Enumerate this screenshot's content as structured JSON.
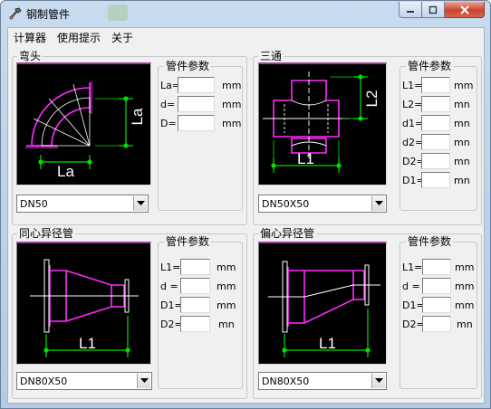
{
  "window": {
    "title": "钢制管件"
  },
  "menu": [
    "计算器",
    "使用提示",
    "关于"
  ],
  "unit_mm": "mm",
  "unit_mn": "mn",
  "panels": {
    "elbow": {
      "title": "弯头",
      "select_value": "DN50",
      "params_title": "管件参数",
      "fields": [
        "La=",
        "d=",
        "D="
      ],
      "dim_labels": [
        "La",
        "La"
      ]
    },
    "tee": {
      "title": "三通",
      "select_value": "DN50X50",
      "params_title": "管件参数",
      "fields": [
        "L1=",
        "L2=",
        "d1=",
        "d2=",
        "D2=",
        "D1="
      ],
      "dim_labels": [
        "L1",
        "L2"
      ]
    },
    "concentric": {
      "title": "同心异径管",
      "select_value": "DN80X50",
      "params_title": "管件参数",
      "fields": [
        "L1=",
        "d =",
        "D1=",
        "D2="
      ],
      "dim_labels": [
        "L1"
      ]
    },
    "eccentric": {
      "title": "偏心异径管",
      "select_value": "DN80X50",
      "params_title": "管件参数",
      "fields": [
        "L1=",
        "d =",
        "D1=",
        "D2="
      ],
      "dim_labels": [
        "L1"
      ]
    }
  },
  "icons": {
    "app": "pipe-wrench-icon",
    "dropdown": "chevron-down-icon"
  },
  "colors": {
    "pipe": "#ff2cff",
    "dimension": "#00e000",
    "centerline": "#ffffff",
    "canvas": "#000000"
  }
}
